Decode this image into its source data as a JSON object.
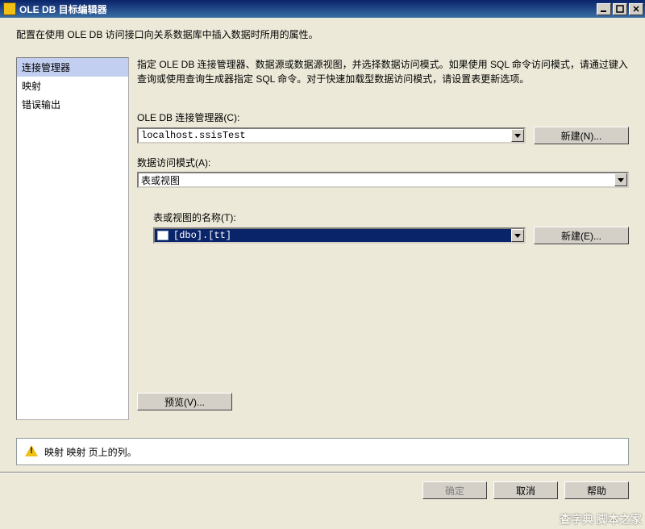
{
  "window": {
    "title": "OLE DB 目标编辑器"
  },
  "description": "配置在使用 OLE DB 访问接口向关系数据库中插入数据时所用的属性。",
  "sidebar": {
    "items": [
      {
        "label": "连接管理器",
        "selected": true
      },
      {
        "label": "映射",
        "selected": false
      },
      {
        "label": "错误输出",
        "selected": false
      }
    ]
  },
  "hint": "指定 OLE DB 连接管理器、数据源或数据源视图，并选择数据访问模式。如果使用 SQL 命令访问模式，请通过键入查询或使用查询生成器指定 SQL 命令。对于快速加载型数据访问模式，请设置表更新选项。",
  "fields": {
    "connection_label": "OLE DB 连接管理器(C):",
    "connection_value": "localhost.ssisTest",
    "access_label": "数据访问模式(A):",
    "access_value": "表或视图",
    "table_label": "表或视图的名称(T):",
    "table_value": "[dbo].[tt]"
  },
  "buttons": {
    "new1": "新建(N)...",
    "new2": "新建(E)...",
    "preview": "预览(V)...",
    "ok": "确定",
    "cancel": "取消",
    "help": "帮助"
  },
  "status": "映射 映射 页上的列。",
  "watermark": "查字典 脚本之家"
}
